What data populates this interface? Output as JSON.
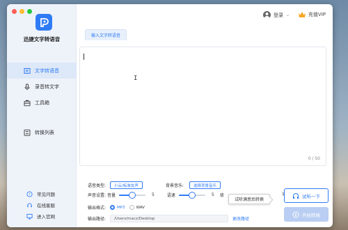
{
  "app": {
    "name": "迅捷文字转语音"
  },
  "sidebar": {
    "items": [
      {
        "label": "文字转语音",
        "icon": "text-to-speech-icon",
        "active": true
      },
      {
        "label": "录音转文字",
        "icon": "recording-icon",
        "active": false
      },
      {
        "label": "工具箱",
        "icon": "toolbox-icon",
        "active": false
      },
      {
        "label": "转换列表",
        "icon": "list-icon",
        "active": false
      }
    ],
    "bottom_links": [
      {
        "label": "常见问题",
        "icon": "question-icon"
      },
      {
        "label": "在线客服",
        "icon": "headset-icon"
      },
      {
        "label": "进入官网",
        "icon": "monitor-icon"
      }
    ]
  },
  "header": {
    "login_label": "登录",
    "vip_label": "充值VIP"
  },
  "editor": {
    "tab_label": "输入文字转语音",
    "counter": "0 / 50"
  },
  "settings": {
    "voice_type_label": "语音类型:",
    "voice_type_value": "小云/标准女声",
    "bg_music_label": "背景音乐:",
    "bg_music_button": "选择背景音乐",
    "sound_settings_label": "声音设置:",
    "volume_label": "音量",
    "volume_value": "5",
    "volume_level": 0.5,
    "speed_label": "语速",
    "speed_value": "5",
    "speed_level": 0.5,
    "truncated_label": "背",
    "truncated_value": "1",
    "output_format_label": "输出格式:",
    "formats": [
      "MP3",
      "WAV"
    ],
    "selected_format": "MP3",
    "output_path_label": "输出路径:",
    "output_path_value": "/Users/macz/Desktop",
    "change_path_label": "更改路径"
  },
  "tooltip": "试听满意后转换",
  "actions": {
    "listen_label": "试听一下",
    "convert_label": "开始转换"
  },
  "colors": {
    "accent": "#2f7bf5",
    "sidebar_bg": "#eef3fa",
    "convert_disabled": "#b9cef2"
  }
}
